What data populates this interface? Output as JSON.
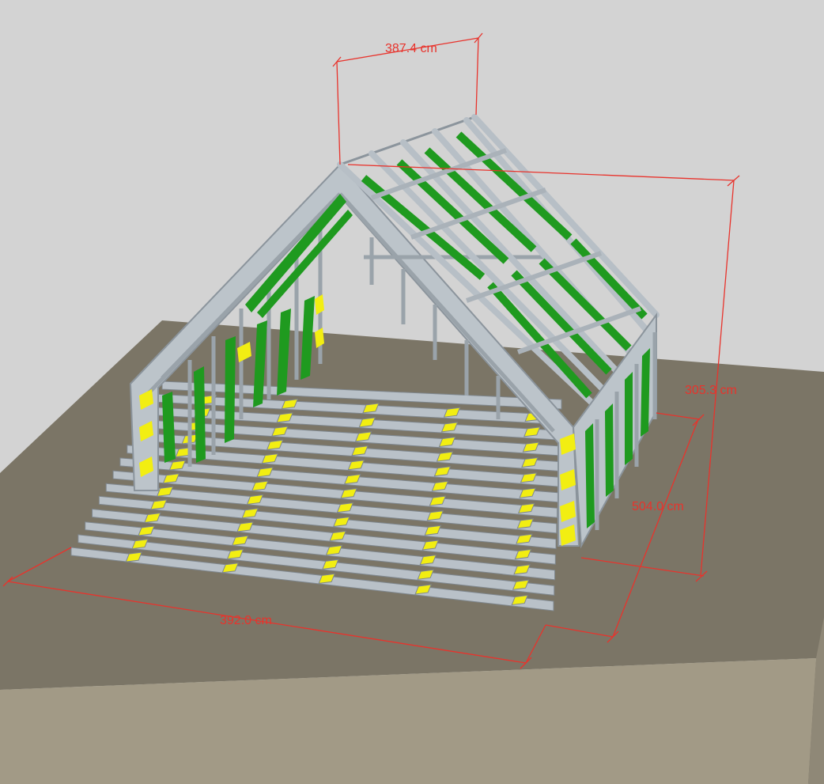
{
  "colors": {
    "background": "#d3d3d3",
    "ground_top": "#7b7566",
    "ground_side": "#a29a86",
    "steel": "#b9c1c8",
    "steel_dark": "#8b949c",
    "brace_green": "#1f9a1f",
    "brace_yellow": "#f2ee12",
    "dimension": "#e8332c"
  },
  "dimensions": {
    "ridge_length": "387.4 cm",
    "overall_height": "305.3 cm",
    "depth": "504.0 cm",
    "width": "392.0 cm"
  }
}
